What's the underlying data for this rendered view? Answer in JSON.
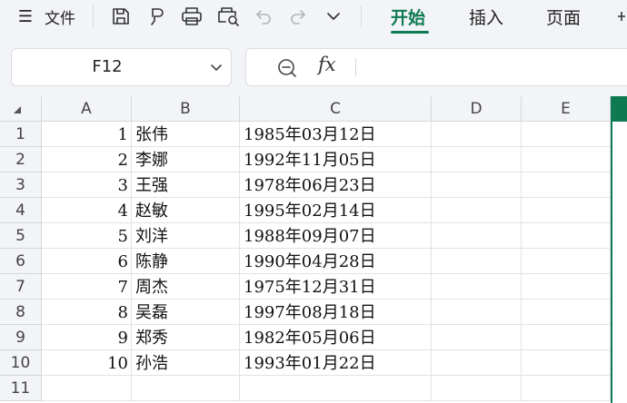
{
  "toolbar": {
    "menu_icon": "☰",
    "file_label": "文件",
    "icons": [
      "save-icon",
      "format-painter-icon",
      "print-icon",
      "print-preview-icon",
      "undo-icon",
      "redo-icon",
      "more-chevron-icon"
    ],
    "tabs": [
      {
        "label": "开始",
        "active": true
      },
      {
        "label": "插入",
        "active": false
      },
      {
        "label": "页面",
        "active": false
      }
    ]
  },
  "formula_bar": {
    "name_box": "F12",
    "fx_label": "fx",
    "formula": ""
  },
  "sheet": {
    "columns": [
      "A",
      "B",
      "C",
      "D",
      "E"
    ],
    "rows": [
      {
        "n": "1",
        "a": "1",
        "b": "张伟",
        "c": "1985年03月12日"
      },
      {
        "n": "2",
        "a": "2",
        "b": "李娜",
        "c": "1992年11月05日"
      },
      {
        "n": "3",
        "a": "3",
        "b": "王强",
        "c": "1978年06月23日"
      },
      {
        "n": "4",
        "a": "4",
        "b": "赵敏",
        "c": "1995年02月14日"
      },
      {
        "n": "5",
        "a": "5",
        "b": "刘洋",
        "c": "1988年09月07日"
      },
      {
        "n": "6",
        "a": "6",
        "b": "陈静",
        "c": "1990年04月28日"
      },
      {
        "n": "7",
        "a": "7",
        "b": "周杰",
        "c": "1975年12月31日"
      },
      {
        "n": "8",
        "a": "8",
        "b": "吴磊",
        "c": "1997年08月18日"
      },
      {
        "n": "9",
        "a": "9",
        "b": "郑秀",
        "c": "1982年05月06日"
      },
      {
        "n": "10",
        "a": "10",
        "b": "孙浩",
        "c": "1993年01月22日"
      },
      {
        "n": "11",
        "a": "",
        "b": "",
        "c": ""
      }
    ]
  },
  "colors": {
    "accent": "#0f7a52",
    "chrome": "#f3f4f7",
    "grid": "#e1e2e5"
  }
}
